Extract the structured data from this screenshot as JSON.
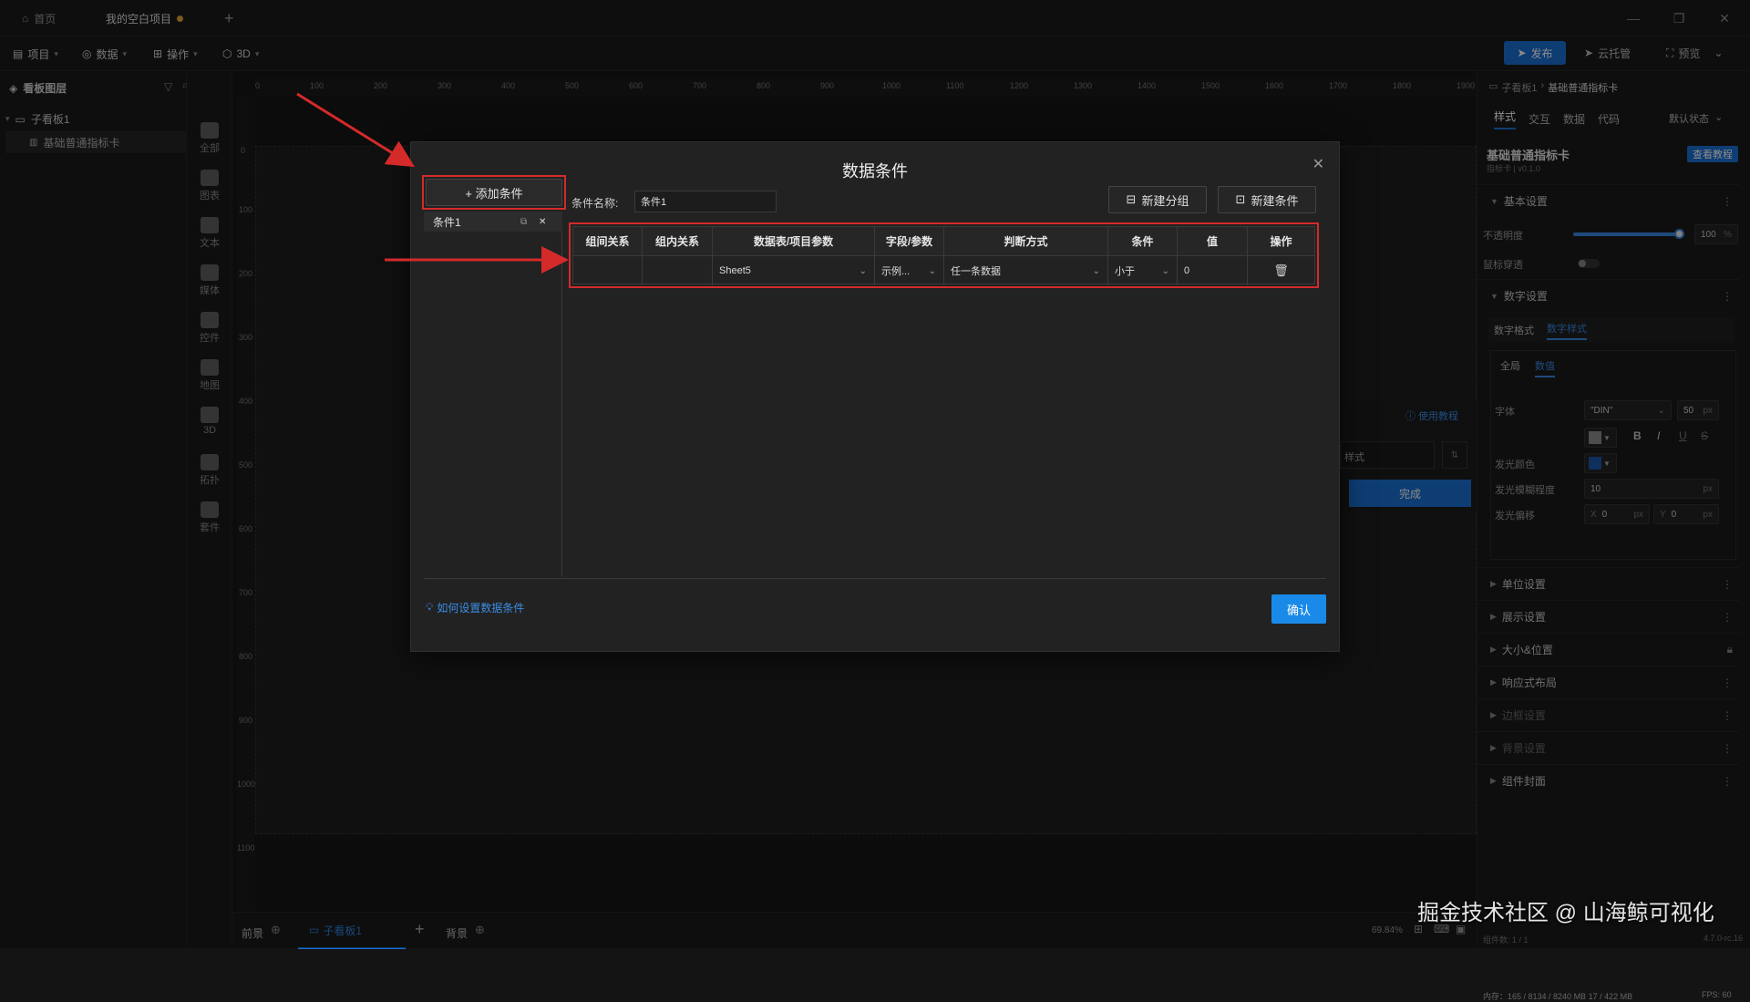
{
  "titlebar": {
    "home_tab": "首页",
    "project_tab": "我的空白项目",
    "new_tab": "+"
  },
  "menubar": {
    "items": [
      "项目",
      "数据",
      "操作",
      "3D"
    ],
    "publish": "发布",
    "cloud": "云托管",
    "preview": "预览"
  },
  "layers": {
    "title": "看板图层",
    "board": "子看板1",
    "widget": "基础普通指标卡"
  },
  "iconbar": [
    "全部",
    "图表",
    "文本",
    "媒体",
    "控件",
    "地图",
    "3D",
    "拓扑",
    "套件"
  ],
  "ruler": {
    "top": [
      "0",
      "100",
      "200",
      "300",
      "400",
      "500",
      "600",
      "700",
      "800",
      "900",
      "1000",
      "1100",
      "1200",
      "1300",
      "1400",
      "1500",
      "1600",
      "1700",
      "1800",
      "1900"
    ],
    "left": [
      "0",
      "100",
      "200",
      "300",
      "400",
      "500",
      "600",
      "700",
      "800",
      "900",
      "1000",
      "1100"
    ]
  },
  "bottombar": {
    "front": "前景",
    "board_tab": "子看板1",
    "back": "背景",
    "zoom": "69.84%",
    "perf": "FPS: 60",
    "mem": "内存：165 / 8134 / 8240 MB  17 / 422 MB",
    "count": "组件数: 1 / 1",
    "version": "4.7.0-rc.16"
  },
  "rightpanel": {
    "breadcrumb_a": "子看板1",
    "breadcrumb_b": "基础普通指标卡",
    "tabs": [
      "样式",
      "交互",
      "数据",
      "代码"
    ],
    "state": "默认状态",
    "widget_name": "基础普通指标卡",
    "widget_sub": "指标卡 | v0.1.0",
    "tutorial_btn": "查看教程",
    "basic_settings": "基本设置",
    "opacity_label": "不透明度",
    "opacity_value": "100",
    "opacity_unit": "%",
    "opacity_level": 1.0,
    "mouse_label": "鼠标穿透",
    "digit_settings": "数字设置",
    "digit_tabs": [
      "数字格式",
      "数字样式"
    ],
    "sub_tabs": [
      "全局",
      "数值"
    ],
    "font_label": "字体",
    "font_value": "\"DIN\"",
    "font_size": "50",
    "px": "px",
    "glow_color_label": "发光颜色",
    "glow_blur_label": "发光模糊程度",
    "glow_blur_value": "10",
    "glow_offset_label": "发光偏移",
    "x_label": "X",
    "x_value": "0",
    "y_label": "Y",
    "y_value": "0",
    "sections": [
      "单位设置",
      "展示设置",
      "大小&位置",
      "响应式布局",
      "边框设置",
      "背景设置",
      "组件封面"
    ],
    "tutorial_link": "使用教程",
    "style_placeholder": "样式",
    "done_btn": "完成"
  },
  "dialog": {
    "title": "数据条件",
    "add_condition": "+ 添加条件",
    "condition_item": "条件1",
    "name_label": "条件名称:",
    "name_value": "条件1",
    "new_group": "新建分组",
    "new_condition": "新建条件",
    "headers": [
      "组间关系",
      "组内关系",
      "数据表/项目参数",
      "字段/参数",
      "判断方式",
      "条件",
      "值",
      "操作"
    ],
    "row": {
      "inter": "",
      "intra": "",
      "table": "Sheet5",
      "field": "示例...",
      "method": "任一条数据",
      "cond": "小于",
      "value": "0"
    },
    "help": "如何设置数据条件",
    "confirm": "确认"
  },
  "watermark": "掘金技术社区 @ 山海鲸可视化",
  "colors": {
    "accent": "#1a8ae8",
    "annotation_red": "#d42a2a",
    "unsaved_dot": "#e8a33c"
  }
}
